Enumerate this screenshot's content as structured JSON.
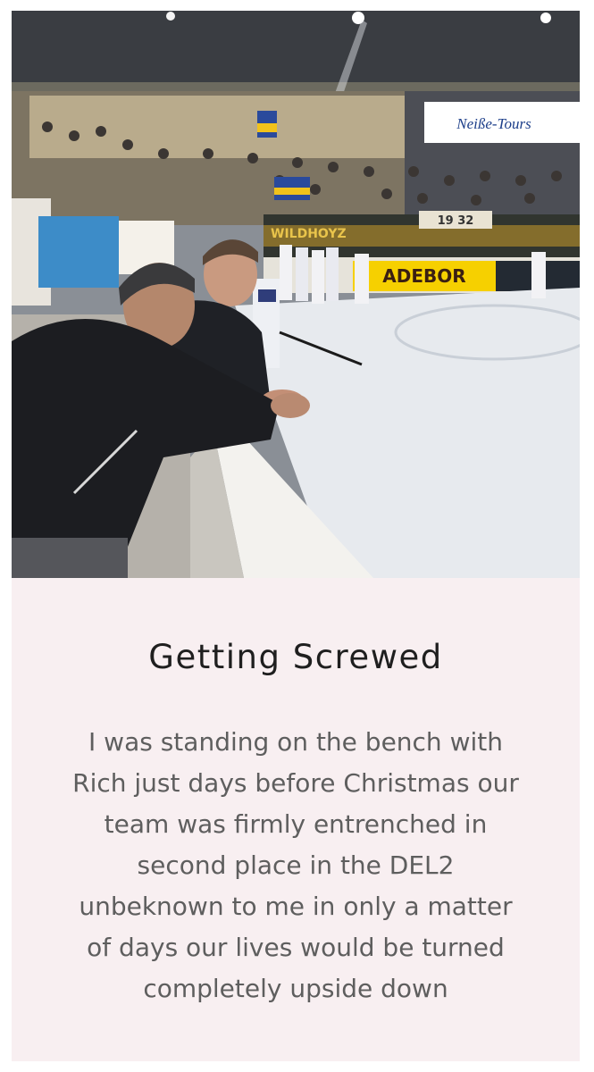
{
  "post": {
    "photo": {
      "sign_tour": "Neiße-Tours",
      "sign_board": "ADEBOR",
      "sign_fan": "WILDHOYZ",
      "sign_year": "19 32"
    },
    "title": "Getting Screwed",
    "body": "I was standing on the bench with Rich just days before Christmas our team was firmly entrenched in second place in the DEL2 unbeknown to me in only a matter of days our lives would be turned completely upside down"
  }
}
